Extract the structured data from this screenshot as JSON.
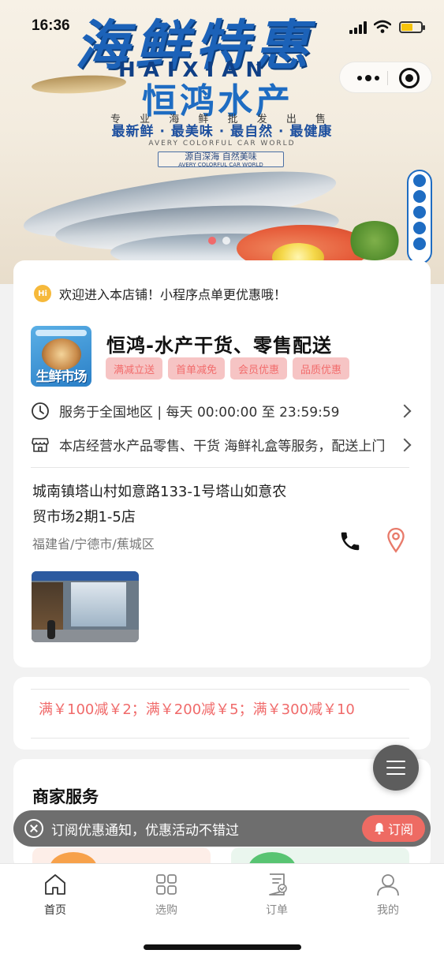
{
  "status_bar": {
    "time": "16:36"
  },
  "banner": {
    "script_title": "海鲜特惠",
    "pinyin": "HAIXIAN",
    "brand_name": "恒鸿水产",
    "tagline_top": "专 业 海 鲜 批 发 出 售",
    "tagline_main": "最新鲜 · 最美味 · 最自然 · 最健康",
    "tagline_en": "AVERY COLORFUL CAR WORLD",
    "ribbon_cn": "源自深海 自然美味",
    "ribbon_en": "AVERY COLORFUL CAR WORLD",
    "carousel_count": 2,
    "carousel_active_index": 0
  },
  "store": {
    "welcome_icon_text": "Hi",
    "welcome": "欢迎进入本店铺！小程序点单更优惠哦！",
    "logo_text": "生鲜市场",
    "name": "恒鸿-水产干货、零售配送",
    "tags": [
      "满减立送",
      "首单减免",
      "会员优惠",
      "品质优惠"
    ],
    "hours": "服务于全国地区 | 每天 00:00:00 至 23:59:59",
    "services": "本店经营水产品零售、干货 海鲜礼盒等服务，配送上门",
    "address_line1": "城南镇塔山村如意路133-1号塔山如意农",
    "address_line2": "贸市场2期1-5店",
    "region": "福建省/宁德市/蕉城区"
  },
  "promo": {
    "text": "满￥100减￥2；满￥200减￥5；满￥300减￥10"
  },
  "merchant_services": {
    "title": "商家服务"
  },
  "subscribe_bar": {
    "message": "订阅优惠通知，优惠活动不错过",
    "button": "订阅"
  },
  "tab_bar": {
    "items": [
      {
        "label": "首页",
        "icon": "home-icon",
        "active": true
      },
      {
        "label": "选购",
        "icon": "grid-icon",
        "active": false
      },
      {
        "label": "订单",
        "icon": "order-icon",
        "active": false
      },
      {
        "label": "我的",
        "icon": "user-icon",
        "active": false
      }
    ]
  },
  "colors": {
    "accent_red": "#f06a6a",
    "tag_bg": "#f6c4c4",
    "brand_blue": "#1e6cc2",
    "subscribe_button": "#ee6b63"
  }
}
